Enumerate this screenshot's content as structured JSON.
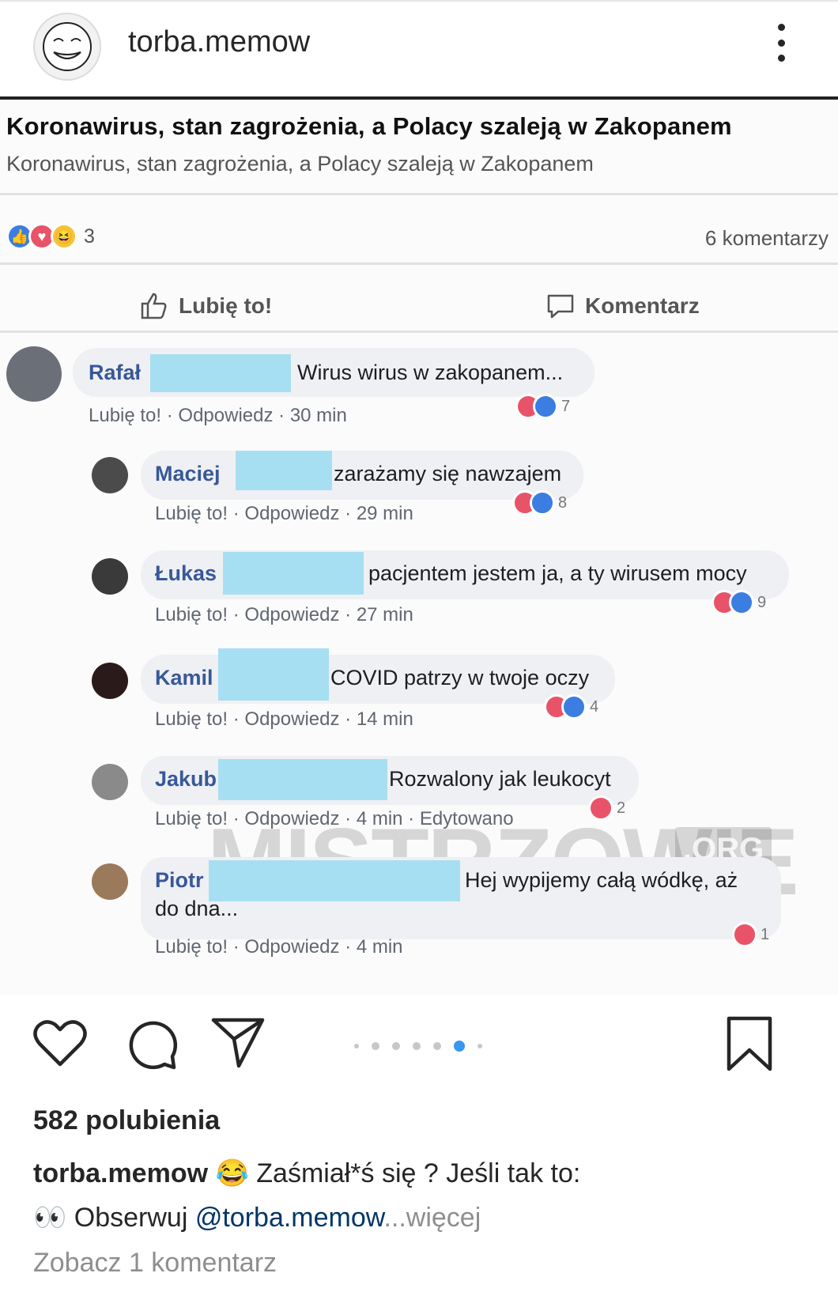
{
  "header": {
    "username": "torba.memow",
    "avatar_icon": "troll-face-icon",
    "more_icon": "more-vertical-icon"
  },
  "post": {
    "article_title": "Koronawirus, stan zagrożenia, a Polacy szaleją w Zakopanem",
    "article_subtitle": "Koronawirus, stan zagrożenia, a Polacy szaleją w Zakopanem",
    "reaction_count": "3",
    "comments_count": "6 komentarzy",
    "like_action": "Lubię to!",
    "comment_action": "Komentarz",
    "comments": [
      {
        "name": "Rafał",
        "text": "Wirus wirus w zakopanem...",
        "like": "Lubię to!",
        "reply": "Odpowiedz",
        "time": "30 min",
        "reactions": "7"
      },
      {
        "name": "Maciej",
        "text": "zarażamy się nawzajem",
        "like": "Lubię to!",
        "reply": "Odpowiedz",
        "time": "29 min",
        "reactions": "8"
      },
      {
        "name": "Łukas",
        "text": "pacjentem jestem ja, a ty wirusem mocy",
        "like": "Lubię to!",
        "reply": "Odpowiedz",
        "time": "27 min",
        "reactions": "9"
      },
      {
        "name": "Kamil",
        "text": "COVID patrzy w twoje oczy",
        "like": "Lubię to!",
        "reply": "Odpowiedz",
        "time": "14 min",
        "reactions": "4"
      },
      {
        "name": "Jakub",
        "text": "Rozwalony jak leukocyt",
        "like": "Lubię to!",
        "reply": "Odpowiedz",
        "time": "4 min",
        "edited": "Edytowano",
        "reactions": "2"
      },
      {
        "name": "Piotr",
        "text": "Hej wypijemy całą wódkę, aż",
        "text2": "do dna...",
        "like": "Lubię to!",
        "reply": "Odpowiedz",
        "time": "4 min",
        "reactions": "1"
      }
    ],
    "watermark": "MISTRZOWIE",
    "watermark_org": ".ORG"
  },
  "toolbar": {
    "like_icon": "heart-icon",
    "comment_icon": "comment-icon",
    "share_icon": "send-icon",
    "save_icon": "bookmark-icon",
    "carousel_active_index": 5,
    "carousel_count": 7
  },
  "footer": {
    "likes": "582 polubienia",
    "caption_username": "torba.memow",
    "caption_emoji": "😂",
    "caption_text": " Zaśmiał*ś się ? Jeśli tak to:",
    "caption_emoji2": "👀",
    "caption_text2": " Obserwuj ",
    "caption_mention": "@torba.memow",
    "caption_more": "...więcej",
    "view_comments": "Zobacz 1 komentarz"
  }
}
